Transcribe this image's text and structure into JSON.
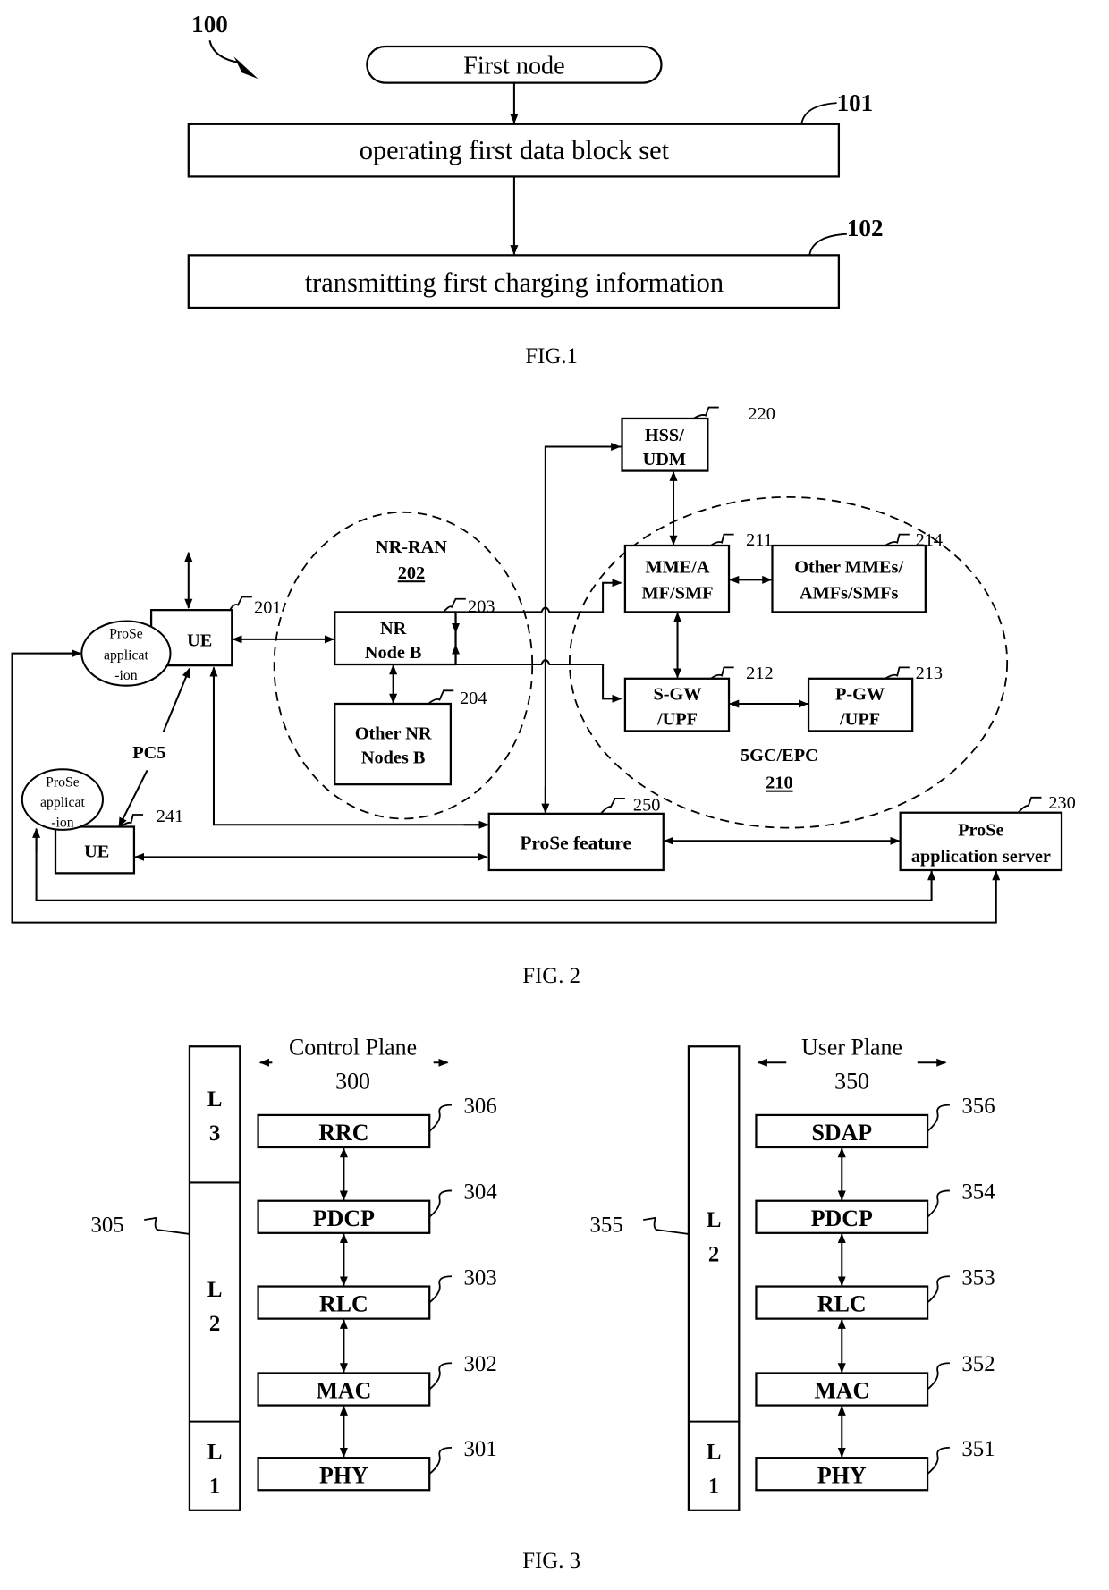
{
  "fig1": {
    "ref": "100",
    "start": "First node",
    "steps": [
      {
        "ref": "101",
        "label": "operating first data block set"
      },
      {
        "ref": "102",
        "label": "transmitting first charging information"
      }
    ],
    "caption": "FIG.1"
  },
  "fig2": {
    "caption": "FIG. 2",
    "ue1": {
      "label": "UE",
      "ref": "201"
    },
    "ue2": {
      "label": "UE",
      "ref": "241"
    },
    "prose_app1": [
      "ProSe",
      "applicat",
      "-ion"
    ],
    "prose_app2": [
      "ProSe",
      "applicat",
      "-ion"
    ],
    "pc5": "PC5",
    "nr_ran": {
      "label": "NR-RAN",
      "ref": "202"
    },
    "nr_node_b": {
      "lines": [
        "NR",
        "Node B"
      ],
      "ref": "203"
    },
    "other_nr": {
      "lines": [
        "Other NR",
        "Nodes B"
      ],
      "ref": "204"
    },
    "hss": {
      "lines": [
        "HSS/",
        "UDM"
      ],
      "ref": "220"
    },
    "mme": {
      "lines": [
        "MME/A",
        "MF/SMF"
      ],
      "ref": "211"
    },
    "other_mme": {
      "lines": [
        "Other MMEs/",
        "AMFs/SMFs"
      ],
      "ref": "214"
    },
    "sgw": {
      "lines": [
        "S-GW",
        "/UPF"
      ],
      "ref": "212"
    },
    "pgw": {
      "lines": [
        "P-GW",
        "/UPF"
      ],
      "ref": "213"
    },
    "core": {
      "label": "5GC/EPC",
      "ref": "210"
    },
    "prose_feature": {
      "label": "ProSe feature",
      "ref": "250"
    },
    "prose_server": {
      "lines": [
        "ProSe",
        "application server"
      ],
      "ref": "230"
    }
  },
  "fig3": {
    "caption": "FIG. 3",
    "control": {
      "title": "Control Plane",
      "ref": "300",
      "column_ref": "305",
      "layers": [
        {
          "l": "L",
          "n": "3"
        },
        {
          "l": "L",
          "n": "2"
        },
        {
          "l": "L",
          "n": "1"
        }
      ],
      "protocols": [
        {
          "label": "RRC",
          "ref": "306"
        },
        {
          "label": "PDCP",
          "ref": "304"
        },
        {
          "label": "RLC",
          "ref": "303"
        },
        {
          "label": "MAC",
          "ref": "302"
        },
        {
          "label": "PHY",
          "ref": "301"
        }
      ]
    },
    "user": {
      "title": "User Plane",
      "ref": "350",
      "column_ref": "355",
      "layers": [
        {
          "l": "L",
          "n": "2"
        },
        {
          "l": "L",
          "n": "1"
        }
      ],
      "protocols": [
        {
          "label": "SDAP",
          "ref": "356"
        },
        {
          "label": "PDCP",
          "ref": "354"
        },
        {
          "label": "RLC",
          "ref": "353"
        },
        {
          "label": "MAC",
          "ref": "352"
        },
        {
          "label": "PHY",
          "ref": "351"
        }
      ]
    }
  }
}
